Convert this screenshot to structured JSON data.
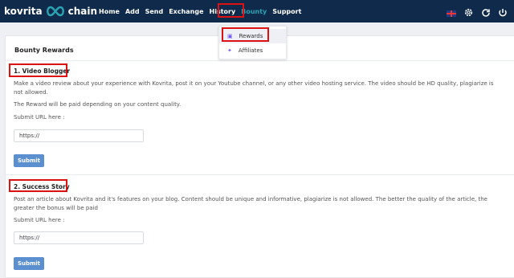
{
  "brand": {
    "name_left": "kovrita",
    "name_right": "chain"
  },
  "nav": {
    "items": [
      "Home",
      "Add",
      "Send",
      "Exchange",
      "History",
      "Bounty",
      "Support"
    ],
    "active": "Bounty"
  },
  "dropdown": {
    "items": [
      {
        "label": "Rewards",
        "icon": "gift-icon"
      },
      {
        "label": "Affiliates",
        "icon": "star-icon"
      }
    ]
  },
  "page": {
    "title": "Bounty Rewards"
  },
  "sections": [
    {
      "title": "1. Video Blogger",
      "description": "Make a video review about your experience with Kovrita, post it on your Youtube channel, or any other video hosting service. The video should be HD quality, plagiarize is not allowed.",
      "note": "The Reward will be paid depending on your content quality.",
      "submit_label": "Submit URL here :",
      "url_value": "https://",
      "button": "Submit"
    },
    {
      "title": "2. Success Story",
      "description": "Post an article about Kovrita and it's features on your blog. Content should be unique and informative, plagiarize is not allowed. The better the quality of the article, the greater the bonus will be paid",
      "submit_label": "Submit URL here :",
      "url_value": "https://",
      "button": "Submit"
    }
  ],
  "colors": {
    "topbar": "#0f2a4a",
    "accent": "#2aa3b2",
    "button": "#5b8fd0",
    "highlight": "#dd1111"
  }
}
